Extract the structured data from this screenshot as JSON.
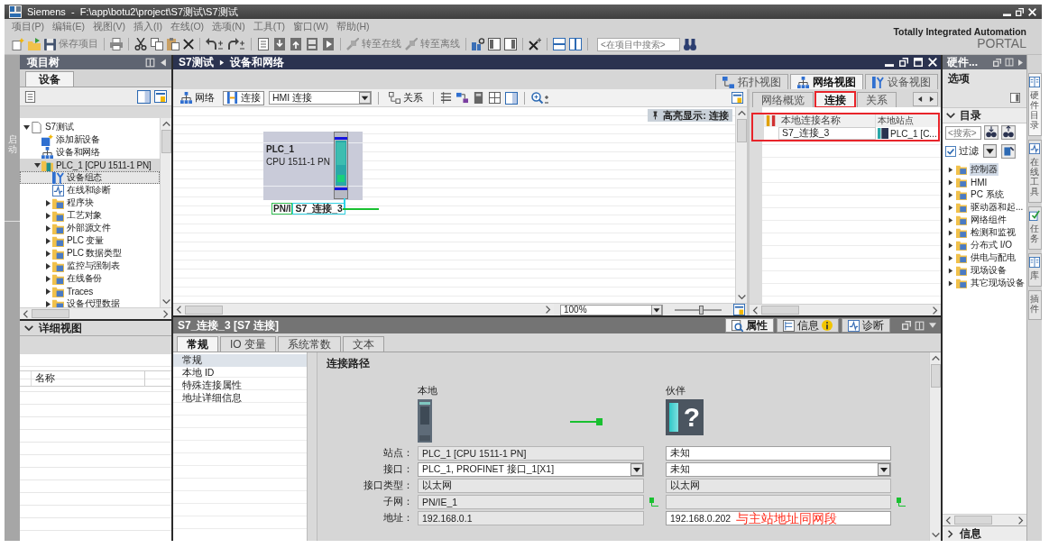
{
  "window": {
    "title": "Siemens  -  F:\\app\\botu2\\project\\S7测试\\S7测试"
  },
  "menu": [
    "项目(P)",
    "编辑(E)",
    "视图(V)",
    "插入(I)",
    "在线(O)",
    "选项(N)",
    "工具(T)",
    "窗口(W)",
    "帮助(H)"
  ],
  "toolbar": {
    "save_label": "保存项目",
    "online_label": "转至在线",
    "offline_label": "转至离线",
    "search": {
      "placeholder": "<在项目中搜索>"
    }
  },
  "brand": {
    "tagline": "Totally Integrated Automation",
    "product": "PORTAL"
  },
  "start_tab": {
    "label": "启动"
  },
  "project_tree": {
    "title": "项目树",
    "tabs": [
      {
        "label": "设备",
        "selected": true
      }
    ],
    "items": [
      {
        "label": "S7测试",
        "kind": "project",
        "expanded": true,
        "selected": false,
        "children": [
          {
            "label": "添加新设备",
            "kind": "add",
            "selected": false
          },
          {
            "label": "设备和网络",
            "kind": "network",
            "selected": false
          },
          {
            "label": "PLC_1 [CPU 1511-1 PN]",
            "kind": "device",
            "expanded": true,
            "selected": true,
            "children": [
              {
                "label": "设备组态",
                "kind": "config",
                "selected": true,
                "focused": true
              },
              {
                "label": "在线和诊断",
                "kind": "diagnostics",
                "selected": false
              },
              {
                "label": "程序块",
                "kind": "folder",
                "expanded": false,
                "selected": false
              },
              {
                "label": "工艺对象",
                "kind": "folder",
                "expanded": false,
                "selected": false
              },
              {
                "label": "外部源文件",
                "kind": "folder",
                "expanded": false,
                "selected": false
              },
              {
                "label": "PLC 变量",
                "kind": "folder",
                "expanded": false,
                "selected": false
              },
              {
                "label": "PLC 数据类型",
                "kind": "folder",
                "expanded": false,
                "selected": false
              },
              {
                "label": "监控与强制表",
                "kind": "folder",
                "expanded": false,
                "selected": false
              },
              {
                "label": "在线备份",
                "kind": "folder",
                "expanded": false,
                "selected": false
              },
              {
                "label": "Traces",
                "kind": "folder",
                "expanded": false,
                "selected": false
              },
              {
                "label": "设备代理数据",
                "kind": "folder",
                "expanded": false,
                "selected": false
              }
            ]
          }
        ]
      }
    ]
  },
  "details_view": {
    "title": "详细视图",
    "expanded": true,
    "columns": [
      "名称"
    ]
  },
  "editor": {
    "breadcrumb": [
      "S7测试",
      "设备和网络"
    ],
    "view_tabs": [
      {
        "label": "拓扑视图",
        "kind": "topology",
        "selected": false
      },
      {
        "label": "网络视图",
        "kind": "network",
        "selected": true
      },
      {
        "label": "设备视图",
        "kind": "device",
        "selected": false
      }
    ],
    "modes": [
      {
        "label": "网络",
        "kind": "network",
        "selected": false
      },
      {
        "label": "连接",
        "kind": "connections",
        "selected": true
      }
    ],
    "connection_type": "HMI 连接",
    "relations_label": "关系",
    "highlight_label": "高亮显示: 连接",
    "devices": [
      {
        "name": "PLC_1",
        "model": "CPU 1511-1 PN",
        "port_label": "PN/I",
        "connection_label": "S7_连接_3"
      }
    ],
    "zoom": {
      "value": "100%",
      "level": 0.55
    },
    "overview": {
      "tabs": [
        {
          "label": "网络概览",
          "selected": false,
          "annotated": false
        },
        {
          "label": "连接",
          "selected": true,
          "annotated": true
        },
        {
          "label": "关系",
          "selected": false,
          "annotated": false
        }
      ],
      "table": {
        "annotated": true,
        "columns": [
          "本地连接名称",
          "本地站点"
        ],
        "rows": [
          {
            "cells": [
              "S7_连接_3",
              "PLC_1 [C..."
            ]
          }
        ]
      }
    }
  },
  "inspector": {
    "title": "S7_连接_3 [S7 连接]",
    "panel_tabs": [
      {
        "label": "属性",
        "kind": "properties",
        "selected": true,
        "notice": false
      },
      {
        "label": "信息",
        "kind": "info",
        "selected": false,
        "notice": true
      },
      {
        "label": "诊断",
        "kind": "diagnostics",
        "selected": false,
        "notice": false
      }
    ],
    "tabs": [
      {
        "label": "常规",
        "selected": true
      },
      {
        "label": "IO 变量",
        "selected": false
      },
      {
        "label": "系统常数",
        "selected": false
      },
      {
        "label": "文本",
        "selected": false
      }
    ],
    "nav": [
      {
        "label": "常规",
        "selected": true
      },
      {
        "label": "本地 ID",
        "selected": false
      },
      {
        "label": "特殊连接属性",
        "selected": false
      },
      {
        "label": "地址详细信息",
        "selected": false
      }
    ],
    "section_title": "连接路径",
    "endpoints": [
      {
        "heading": "本地",
        "kind": "cpu"
      },
      {
        "heading": "伙伴",
        "kind": "unknown",
        "glyph": "?"
      }
    ],
    "rows": [
      {
        "label": "站点：",
        "local": {
          "kind": "readonly",
          "value": "PLC_1 [CPU 1511-1 PN]"
        },
        "partner": {
          "kind": "input",
          "value": "未知"
        }
      },
      {
        "label": "接口：",
        "local": {
          "kind": "dropdown",
          "value": "PLC_1, PROFINET 接口_1[X1]"
        },
        "partner": {
          "kind": "dropdown",
          "value": "未知"
        }
      },
      {
        "label": "接口类型：",
        "local": {
          "kind": "readonly",
          "value": "以太网"
        },
        "partner": {
          "kind": "readonly",
          "value": "以太网"
        }
      },
      {
        "label": "子网：",
        "local": {
          "kind": "readonly",
          "value": "PN/IE_1",
          "subnet_link": true
        },
        "partner": {
          "kind": "readonly",
          "subnet_link": true
        }
      },
      {
        "label": "地址：",
        "local": {
          "kind": "readonly",
          "value": "192.168.0.1"
        },
        "partner": {
          "kind": "input",
          "value": "192.168.0.202",
          "note": "与主站地址同网段"
        }
      }
    ]
  },
  "task_card": {
    "title": "硬件...",
    "section": "选项",
    "catalog": {
      "title": "目录",
      "expanded": true,
      "search": {
        "placeholder": "<搜索>"
      },
      "filter": {
        "label": "过滤",
        "checked": true
      },
      "items": [
        {
          "label": "控制器",
          "selected": true,
          "expanded": false
        },
        {
          "label": "HMI",
          "selected": false,
          "expanded": false
        },
        {
          "label": "PC 系统",
          "selected": false,
          "expanded": false
        },
        {
          "label": "驱动器和起...",
          "selected": false,
          "expanded": false
        },
        {
          "label": "网络组件",
          "selected": false,
          "expanded": false
        },
        {
          "label": "检测和监视",
          "selected": false,
          "expanded": false
        },
        {
          "label": "分布式 I/O",
          "selected": false,
          "expanded": false
        },
        {
          "label": "供电与配电",
          "selected": false,
          "expanded": false
        },
        {
          "label": "现场设备",
          "selected": false,
          "expanded": false
        },
        {
          "label": "其它现场设备",
          "selected": false,
          "expanded": false
        }
      ]
    },
    "info": {
      "label": "信息",
      "expanded": false
    }
  },
  "side_tabs": [
    {
      "label": "硬件目录",
      "kind": "catalog",
      "selected": true
    },
    {
      "label": "在线工具",
      "kind": "online",
      "selected": false
    },
    {
      "label": "任务",
      "kind": "tasks",
      "selected": false
    },
    {
      "label": "库",
      "kind": "library",
      "selected": false
    },
    {
      "label": "插件",
      "kind": "plugins",
      "selected": false
    }
  ]
}
